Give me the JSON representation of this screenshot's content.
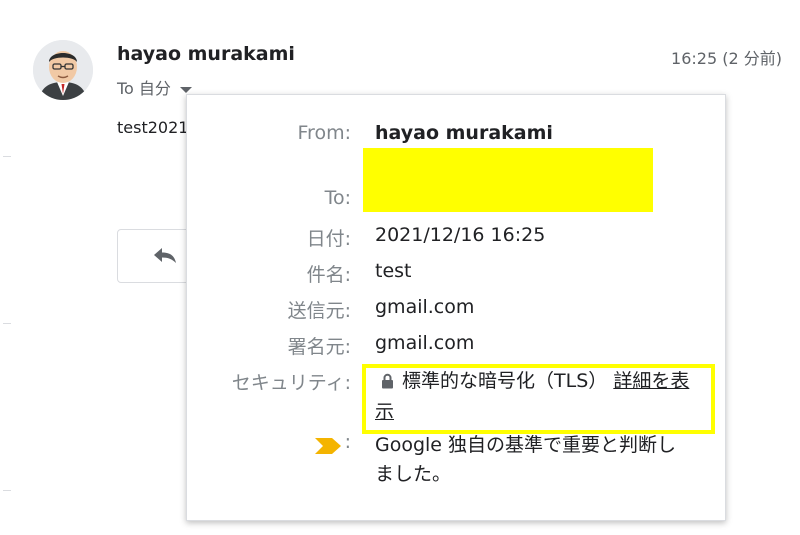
{
  "header": {
    "sender_name": "hayao murakami",
    "recipient_summary": "To 自分",
    "timestamp": "16:25 (2 分前)"
  },
  "message": {
    "snippet": "test2021"
  },
  "details": {
    "from": {
      "label": "From:",
      "value": "hayao murakami"
    },
    "to": {
      "label": "To:"
    },
    "date": {
      "label": "日付:",
      "value": "2021/12/16 16:25"
    },
    "subject": {
      "label": "件名:",
      "value": "test"
    },
    "mailed_by": {
      "label": "送信元:",
      "value": "gmail.com"
    },
    "signed_by": {
      "label": "署名元:",
      "value": "gmail.com"
    },
    "security": {
      "label": "セキュリティ:",
      "value": "標準的な暗号化（TLS）",
      "link": "詳細を表示"
    },
    "importance": {
      "colon": ":",
      "value": "Google 独自の基準で重要と判断しました。"
    }
  },
  "colors": {
    "highlight": "#ffff00",
    "importance_marker": "#f4b400",
    "label_gray": "#80868b"
  },
  "icons": {
    "avatar": "avatar-caricature",
    "caret": "chevron-down-icon",
    "reply": "reply-icon",
    "lock": "lock-icon",
    "importance": "importance-marker-icon"
  }
}
